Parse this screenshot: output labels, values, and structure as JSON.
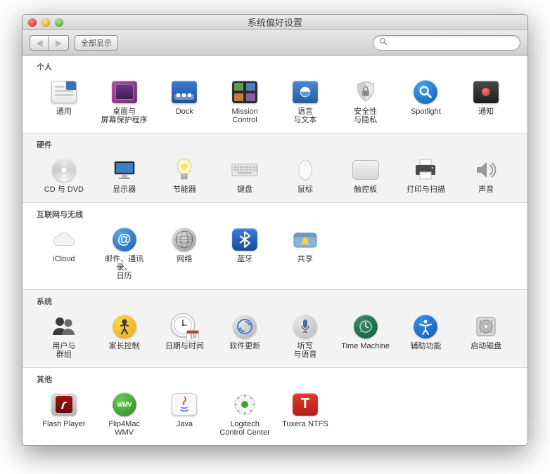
{
  "window_title": "系统偏好设置",
  "toolbar": {
    "show_all": "全部显示",
    "search_placeholder": ""
  },
  "sections": [
    {
      "title": "个人",
      "items": [
        {
          "id": "general",
          "label": "通用"
        },
        {
          "id": "desktop-screensaver",
          "label": "桌面与\n屏幕保护程序"
        },
        {
          "id": "dock",
          "label": "Dock"
        },
        {
          "id": "mission-control",
          "label": "Mission\nControl"
        },
        {
          "id": "language-text",
          "label": "语言\n与文本"
        },
        {
          "id": "security-privacy",
          "label": "安全性\n与隐私"
        },
        {
          "id": "spotlight",
          "label": "Spotlight"
        },
        {
          "id": "notifications",
          "label": "通知"
        }
      ]
    },
    {
      "title": "硬件",
      "items": [
        {
          "id": "cd-dvd",
          "label": "CD 与 DVD"
        },
        {
          "id": "displays",
          "label": "显示器"
        },
        {
          "id": "energy-saver",
          "label": "节能器"
        },
        {
          "id": "keyboard",
          "label": "键盘"
        },
        {
          "id": "mouse",
          "label": "鼠标"
        },
        {
          "id": "trackpad",
          "label": "触控板"
        },
        {
          "id": "print-scan",
          "label": "打印与扫描"
        },
        {
          "id": "sound",
          "label": "声音"
        }
      ]
    },
    {
      "title": "互联网与无线",
      "items": [
        {
          "id": "icloud",
          "label": "iCloud"
        },
        {
          "id": "mail-contacts-calendars",
          "label": "邮件、通讯录、\n日历"
        },
        {
          "id": "network",
          "label": "网络"
        },
        {
          "id": "bluetooth",
          "label": "蓝牙"
        },
        {
          "id": "sharing",
          "label": "共享"
        }
      ]
    },
    {
      "title": "系统",
      "items": [
        {
          "id": "users-groups",
          "label": "用户与\n群组"
        },
        {
          "id": "parental-controls",
          "label": "家长控制"
        },
        {
          "id": "date-time",
          "label": "日期与时间"
        },
        {
          "id": "software-update",
          "label": "软件更新"
        },
        {
          "id": "dictation-speech",
          "label": "听写\n与语音"
        },
        {
          "id": "time-machine",
          "label": "Time Machine"
        },
        {
          "id": "accessibility",
          "label": "辅助功能"
        },
        {
          "id": "startup-disk",
          "label": "启动磁盘"
        }
      ]
    },
    {
      "title": "其他",
      "items": [
        {
          "id": "flash-player",
          "label": "Flash Player"
        },
        {
          "id": "flip4mac-wmv",
          "label": "Flip4Mac\nWMV"
        },
        {
          "id": "java",
          "label": "Java"
        },
        {
          "id": "logitech-control-center",
          "label": "Logitech\nControl Center"
        },
        {
          "id": "tuxera-ntfs",
          "label": "Tuxera NTFS"
        }
      ]
    }
  ]
}
